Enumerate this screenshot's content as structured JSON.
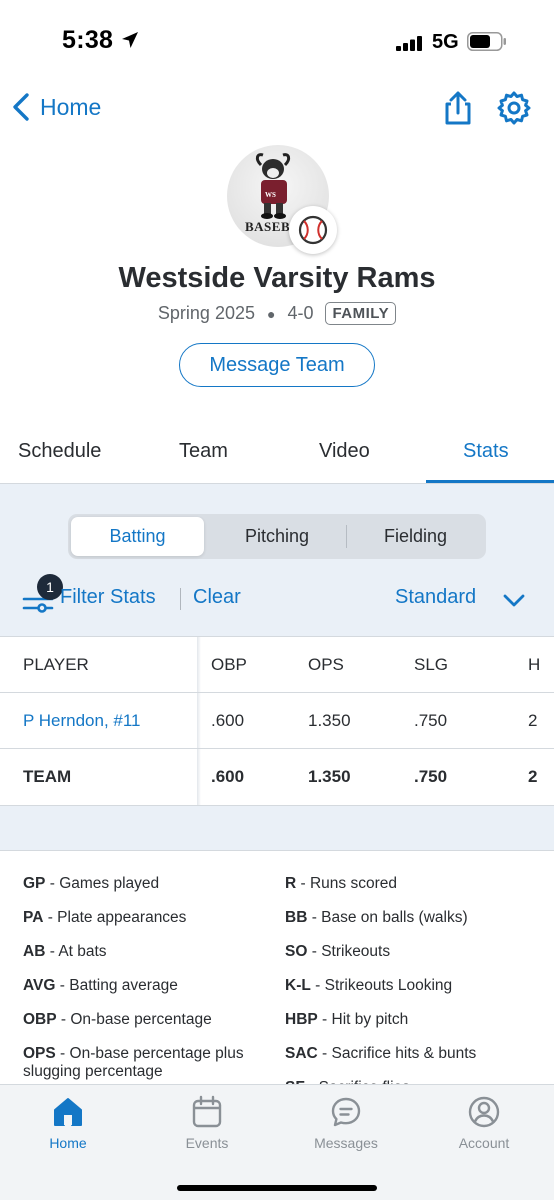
{
  "status_bar": {
    "time": "5:38",
    "network": "5G"
  },
  "nav": {
    "back_label": "Home"
  },
  "team": {
    "logo_text": "BASEBALL",
    "name": "Westside Varsity Rams",
    "season": "Spring 2025",
    "record": "4-0",
    "badge": "FAMILY",
    "message_button": "Message Team"
  },
  "tabs": [
    {
      "label": "Schedule"
    },
    {
      "label": "Team"
    },
    {
      "label": "Video"
    },
    {
      "label": "Stats",
      "active": true
    }
  ],
  "segments": [
    {
      "label": "Batting",
      "selected": true
    },
    {
      "label": "Pitching"
    },
    {
      "label": "Fielding"
    }
  ],
  "filter": {
    "count": "1",
    "label": "Filter Stats",
    "clear": "Clear",
    "view": "Standard"
  },
  "table": {
    "headers": [
      "PLAYER",
      "OBP",
      "OPS",
      "SLG",
      "H"
    ],
    "rows": [
      {
        "player": "P Herndon, #11",
        "obp": ".600",
        "ops": "1.350",
        "slg": ".750",
        "h": "2"
      },
      {
        "player": "TEAM",
        "obp": ".600",
        "ops": "1.350",
        "slg": ".750",
        "h": "2"
      }
    ]
  },
  "legend": {
    "left": [
      {
        "abbr": "GP",
        "desc": "Games played"
      },
      {
        "abbr": "PA",
        "desc": "Plate appearances"
      },
      {
        "abbr": "AB",
        "desc": "At bats"
      },
      {
        "abbr": "AVG",
        "desc": "Batting average"
      },
      {
        "abbr": "OBP",
        "desc": "On-base percentage"
      },
      {
        "abbr": "OPS",
        "desc": "On-base percentage plus",
        "desc2": "slugging percentage"
      }
    ],
    "right": [
      {
        "abbr": "R",
        "desc": "Runs scored"
      },
      {
        "abbr": "BB",
        "desc": "Base on balls (walks)"
      },
      {
        "abbr": "SO",
        "desc": "Strikeouts"
      },
      {
        "abbr": "K-L",
        "desc": "Strikeouts Looking"
      },
      {
        "abbr": "HBP",
        "desc": "Hit by pitch"
      },
      {
        "abbr": "SAC",
        "desc": "Sacrifice hits & bunts"
      },
      {
        "abbr": "SF",
        "desc": "Sacrifice flies"
      }
    ]
  },
  "tabbar": [
    {
      "label": "Home",
      "icon": "home-icon",
      "active": true
    },
    {
      "label": "Events",
      "icon": "calendar-icon"
    },
    {
      "label": "Messages",
      "icon": "chat-icon"
    },
    {
      "label": "Account",
      "icon": "account-icon"
    }
  ],
  "colors": {
    "accent": "#1477c6",
    "stats_bg": "#eaf0f7",
    "text": "#2a2d31"
  }
}
